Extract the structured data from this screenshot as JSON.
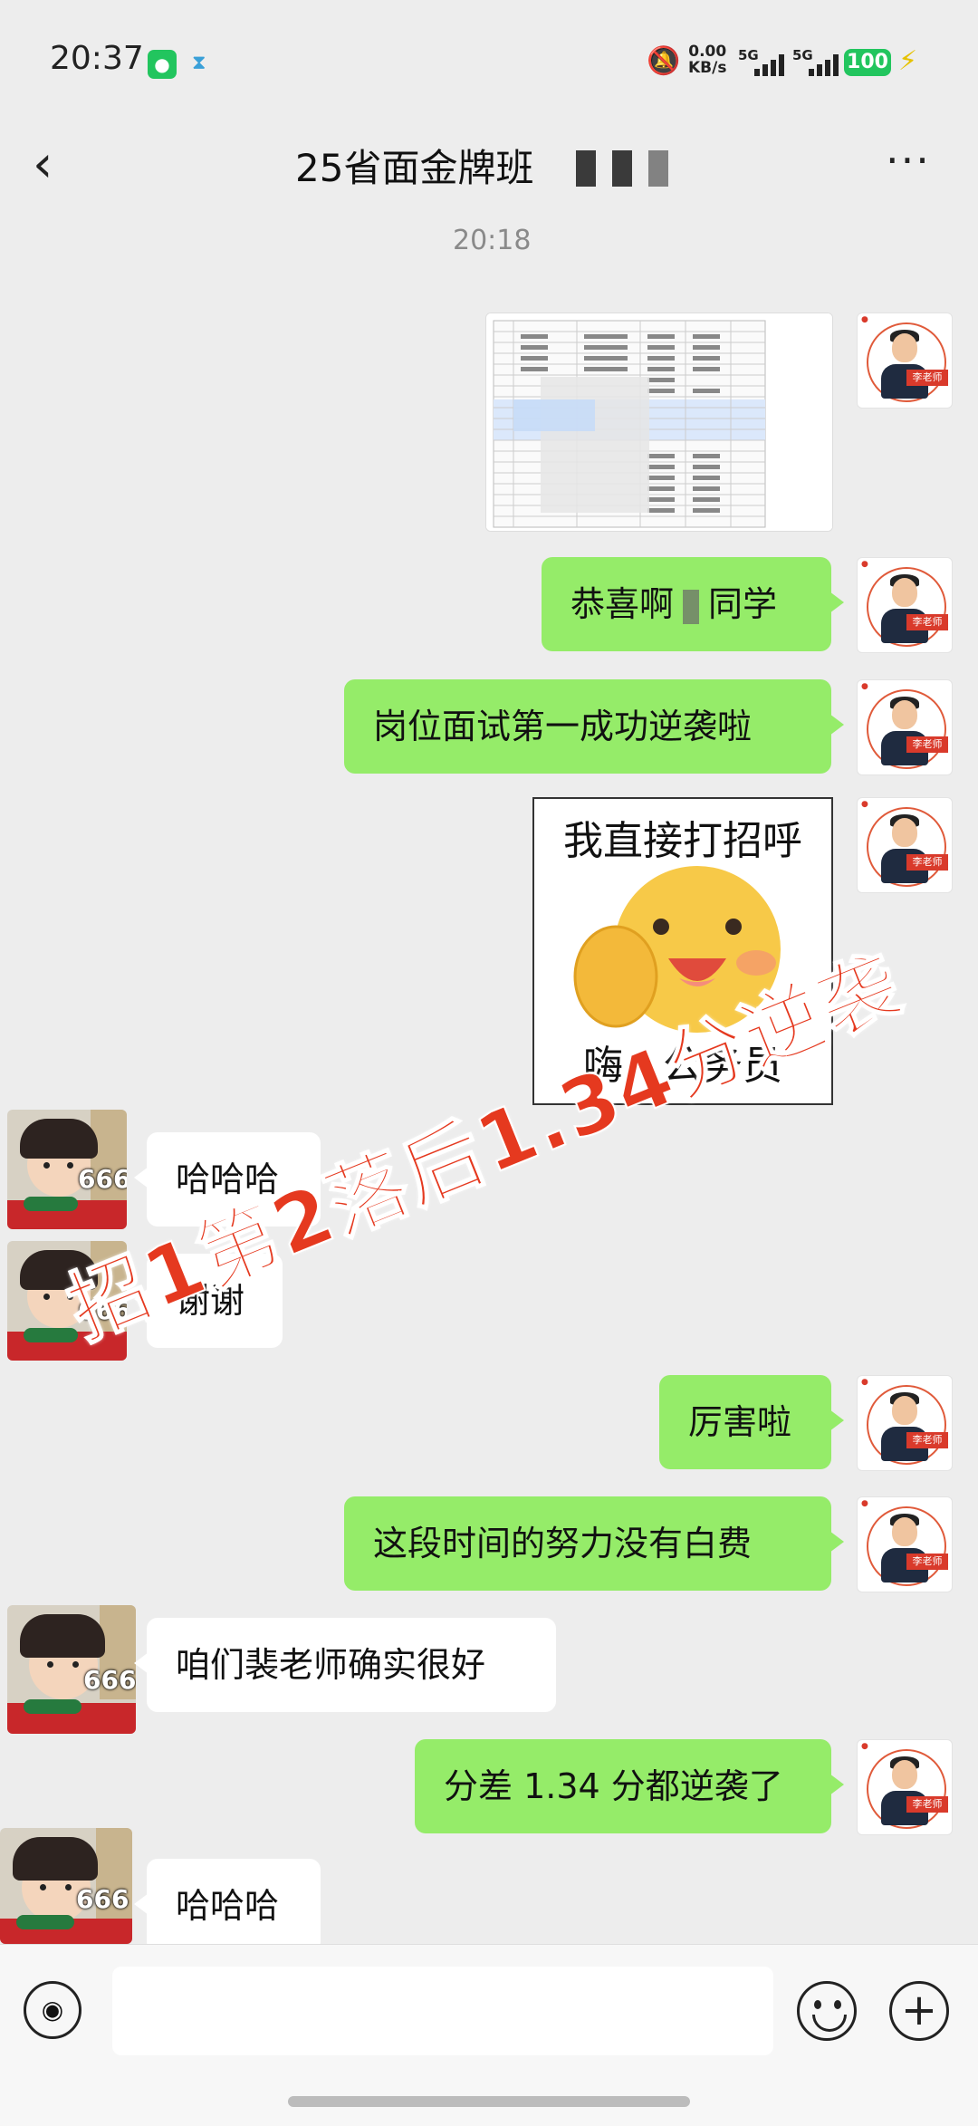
{
  "status_bar": {
    "time": "20:37",
    "net_speed": "0.00",
    "net_unit": "KB/s",
    "signal1": "5G",
    "signal2": "5G",
    "battery": "100"
  },
  "header": {
    "title": "25省面金牌班",
    "back_icon": "chevron-left-icon",
    "more_icon": "more-dots-icon"
  },
  "timestamp": "20:18",
  "messages": [
    {
      "side": "out",
      "type": "image",
      "content": "spreadsheet"
    },
    {
      "side": "out",
      "type": "text",
      "pre": "恭喜啊",
      "post": "同学"
    },
    {
      "side": "out",
      "type": "text",
      "text": "岗位面试第一成功逆袭啦"
    },
    {
      "side": "out",
      "type": "sticker",
      "top": "我直接打招呼",
      "bottom": "嗨，公务员"
    },
    {
      "side": "in",
      "type": "text",
      "text": "哈哈哈"
    },
    {
      "side": "in",
      "type": "text",
      "text": "谢谢"
    },
    {
      "side": "out",
      "type": "text",
      "text": "厉害啦"
    },
    {
      "side": "out",
      "type": "text",
      "text": "这段时间的努力没有白费"
    },
    {
      "side": "in",
      "type": "text",
      "text": "咱们裴老师确实很好"
    },
    {
      "side": "out",
      "type": "text",
      "text": "分差 1.34 分都逆袭了"
    },
    {
      "side": "in",
      "type": "text",
      "text": "哈哈哈"
    }
  ],
  "avatars": {
    "teacher_label": "李老师",
    "kid_label": "666"
  },
  "overlay_text": "招1第2落后1.34分逆袭",
  "input_bar": {
    "placeholder": "",
    "voice_icon": "voice-icon",
    "emoji_icon": "emoji-icon",
    "plus_icon": "plus-icon"
  },
  "colors": {
    "outgoing_bubble": "#95ec69",
    "incoming_bubble": "#ffffff",
    "background": "#ededed",
    "overlay": "#e5391f"
  }
}
